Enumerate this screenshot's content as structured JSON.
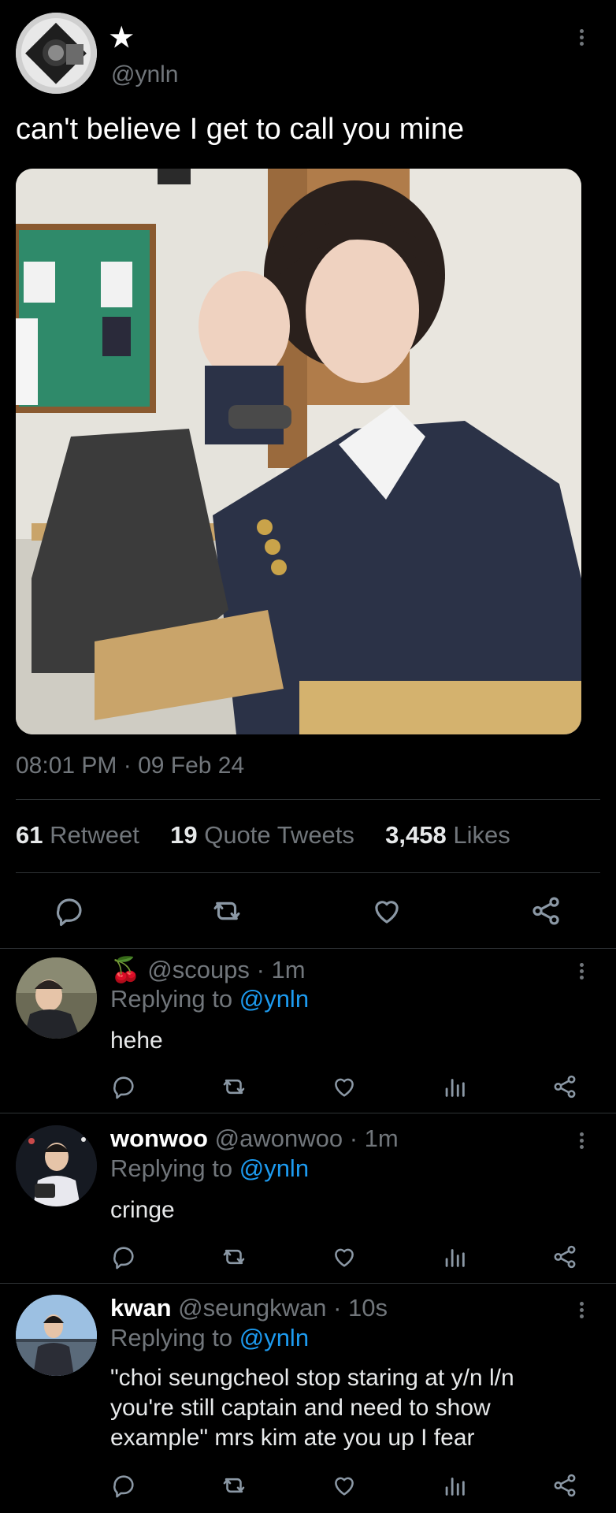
{
  "tweet": {
    "display_name": "★",
    "handle": "@ynln",
    "text": "can't believe I get to call you mine",
    "timestamp": "08:01 PM · 09 Feb 24",
    "stats": {
      "retweets_count": "61",
      "retweets_label": "Retweet",
      "quotes_count": "19",
      "quotes_label": "Quote Tweets",
      "likes_count": "3,458",
      "likes_label": "Likes"
    }
  },
  "replies": [
    {
      "name": "🍒",
      "handle": "@scoups",
      "time": "· 1m",
      "replying_prefix": "Replying to",
      "replying_handle": "@ynln",
      "text": "hehe"
    },
    {
      "name": "wonwoo",
      "handle": "@awonwoo",
      "time": "· 1m",
      "replying_prefix": "Replying to",
      "replying_handle": "@ynln",
      "text": "cringe"
    },
    {
      "name": "kwan",
      "handle": "@seungkwan",
      "time": "· 10s",
      "replying_prefix": "Replying to",
      "replying_handle": "@ynln",
      "text": "\"choi seungcheol stop staring at y/n l/n you're still captain and need to show example\" mrs kim ate you up I fear"
    }
  ],
  "colors": {
    "background": "#000000",
    "text": "#e7e9ea",
    "secondary": "#71767b",
    "link": "#1d9bf0",
    "divider": "#2f3336"
  },
  "icons": [
    "more-icon",
    "reply-icon",
    "retweet-icon",
    "like-icon",
    "share-icon",
    "views-icon"
  ]
}
